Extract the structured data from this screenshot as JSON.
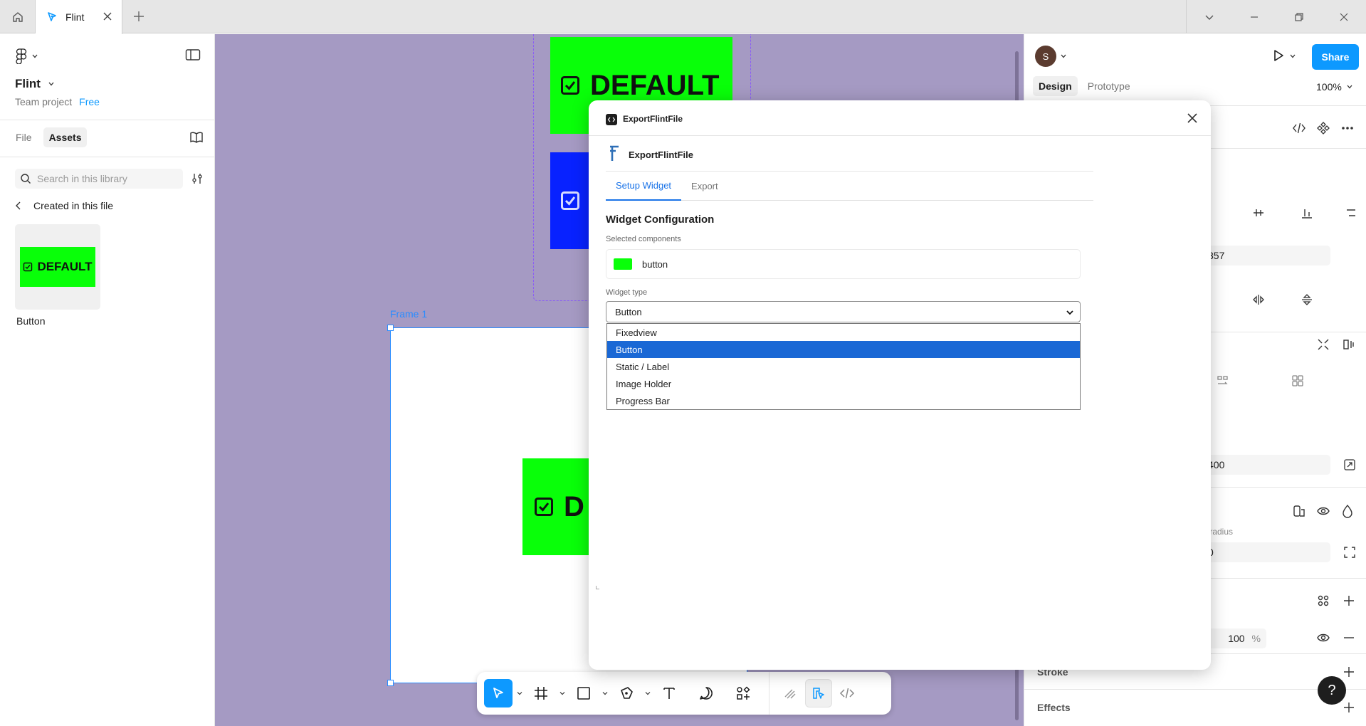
{
  "titlebar": {
    "tab_name": "Flint"
  },
  "left_panel": {
    "project_name": "Flint",
    "team_label": "Team project",
    "plan_badge": "Free",
    "tabs": [
      {
        "label": "File",
        "active": false
      },
      {
        "label": "Assets",
        "active": true
      }
    ],
    "search_placeholder": "Search in this library",
    "back_label": "Created in this file",
    "asset": {
      "thumb_text": "DEFAULT",
      "name": "Button"
    }
  },
  "canvas": {
    "component_text": "DEFAULT",
    "frame_label": "Frame 1",
    "partial_text": "D",
    "background": "#a59ac3",
    "component_green": "#09ff09",
    "component_blue": "#0822ff"
  },
  "right_panel": {
    "avatar_initial": "S",
    "share_label": "Share",
    "tabs": [
      {
        "label": "Design",
        "active": true
      },
      {
        "label": "Prototype",
        "active": false
      }
    ],
    "zoom": "100%",
    "field_value_1": "357",
    "field_value_2": "400",
    "corner_radius_label": "r radius",
    "corner_radius_value": "0",
    "fill_opacity": "100",
    "fill_opacity_unit": "%",
    "stroke_label": "Stroke",
    "effects_label": "Effects",
    "help_label": "?"
  },
  "modal": {
    "title": "ExportFlintFile",
    "plugin_name": "ExportFlintFile",
    "tabs": [
      {
        "label": "Setup Widget",
        "active": true
      },
      {
        "label": "Export",
        "active": false
      }
    ],
    "heading": "Widget Configuration",
    "selected_label": "Selected components",
    "selected_component": "button",
    "widget_type_label": "Widget type",
    "widget_type_value": "Button",
    "options": [
      {
        "label": "Fixedview",
        "selected": false
      },
      {
        "label": "Button",
        "selected": true
      },
      {
        "label": "Static / Label",
        "selected": false
      },
      {
        "label": "Image Holder",
        "selected": false
      },
      {
        "label": "Progress Bar",
        "selected": false
      }
    ]
  },
  "colors": {
    "accent": "#0d99ff",
    "frame_selection": "#2a8cff",
    "option_highlight": "#1a68d5"
  }
}
